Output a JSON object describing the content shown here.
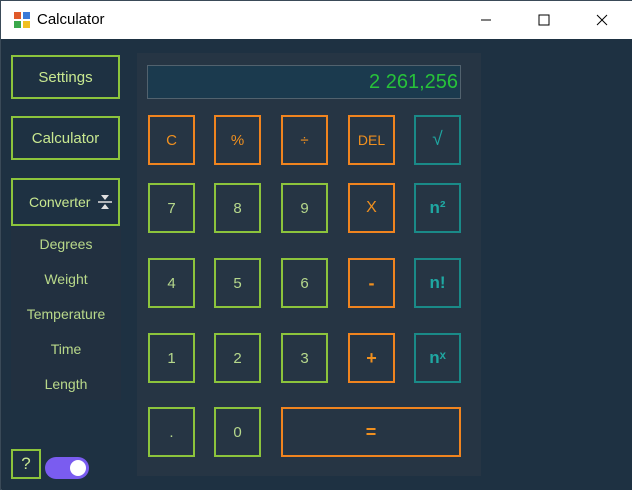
{
  "window": {
    "title": "Calculator"
  },
  "sidebar": {
    "settings_label": "Settings",
    "calculator_label": "Calculator",
    "converter_label": "Converter",
    "converter_items": [
      "Degrees",
      "Weight",
      "Temperature",
      "Time",
      "Length"
    ]
  },
  "display": {
    "value": "2 261,256"
  },
  "keys": {
    "clear": "C",
    "percent": "%",
    "divide": "÷",
    "delete": "DEL",
    "sqrt": "√",
    "seven": "7",
    "eight": "8",
    "nine": "9",
    "multiply": "X",
    "square": "n²",
    "four": "4",
    "five": "5",
    "six": "6",
    "minus": "-",
    "factorial": "n!",
    "one": "1",
    "two": "2",
    "three": "3",
    "plus": "+",
    "power": "nˣ",
    "dot": ".",
    "zero": "0",
    "equals": "="
  },
  "footer": {
    "help_label": "?"
  },
  "colors": {
    "accent_green": "#8cc43c",
    "accent_orange": "#f0841f",
    "accent_teal": "#1a8a88",
    "display_text": "#27c23a",
    "toggle": "#7a5cf0"
  }
}
